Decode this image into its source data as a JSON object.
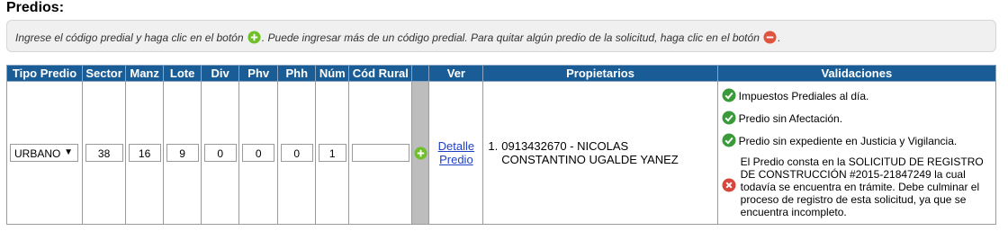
{
  "section": {
    "title": "Predios:"
  },
  "hint": {
    "part1": "Ingrese el código predial y haga clic en el botón",
    "part2": ". Puede ingresar más de un código predial. Para quitar algún predio de la solicitud, haga clic en el botón",
    "part3": "."
  },
  "table": {
    "headers": {
      "tipo": "Tipo Predio",
      "sector": "Sector",
      "manz": "Manz",
      "lote": "Lote",
      "div": "Div",
      "phv": "Phv",
      "phh": "Phh",
      "num": "Núm",
      "rural": "Cód Rural",
      "ver": "Ver",
      "propietarios": "Propietarios",
      "validaciones": "Validaciones"
    },
    "row": {
      "tipo": "URBANO",
      "sector": "38",
      "manz": "16",
      "lote": "9",
      "div": "0",
      "phv": "0",
      "phh": "0",
      "num": "1",
      "rural": "",
      "ver_line1": "Detalle",
      "ver_line2": "Predio",
      "owner_num": "1.",
      "owner_line1": "0913432670 - NICOLAS",
      "owner_line2": "CONSTANTINO UGALDE YANEZ"
    },
    "validations": [
      "Impuestos Prediales al día.",
      "Predio sin Afectación.",
      "Predio sin expediente en Justicia y Vigilancia."
    ],
    "validation_error": "El Predio consta en la SOLICITUD DE REGISTRO DE CONSTRUCCIÓN #2015-21847249 la cual todavía se encuentra en trámite. Debe culminar el proceso de registro de esta solicitud, ya que se encuentra incompleto."
  },
  "colors": {
    "header_bg": "#1a5c96",
    "add_green": "#6fbf2a",
    "remove_red": "#e0533d",
    "check_green": "#3a9a3a",
    "error_red": "#d9453a"
  },
  "icons": {
    "add": "add-circle-icon",
    "remove": "remove-circle-icon",
    "ok": "check-circle-icon",
    "error": "error-circle-icon"
  }
}
